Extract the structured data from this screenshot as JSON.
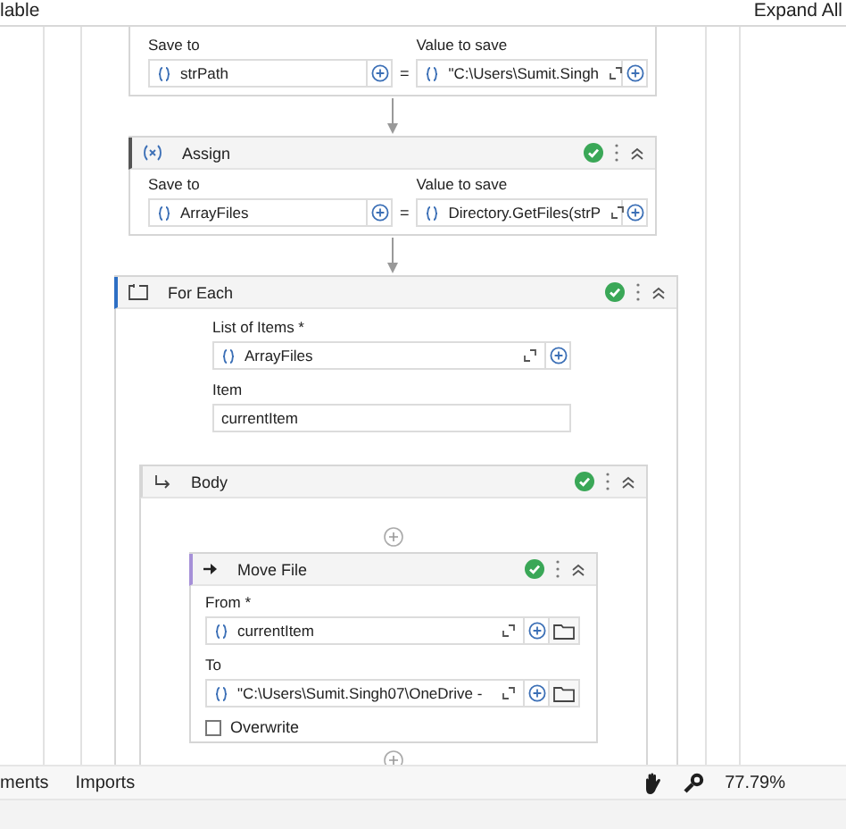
{
  "top_bar": {
    "left": "lable",
    "right": "Expand All"
  },
  "assign_partial": {
    "save_to_label": "Save to",
    "save_to": "strPath",
    "equals": "=",
    "value_label": "Value to save",
    "value": "\"C:\\Users\\Sumit.Singh"
  },
  "assign": {
    "title": "Assign",
    "save_to_label": "Save to",
    "save_to": "ArrayFiles",
    "equals": "=",
    "value_label": "Value to save",
    "value": "Directory.GetFiles(strP"
  },
  "for_each": {
    "title": "For Each",
    "list_label": "List of Items *",
    "list_value": "ArrayFiles",
    "item_label": "Item",
    "item_value": "currentItem",
    "body": {
      "title": "Body",
      "move_file": {
        "title": "Move File",
        "from_label": "From *",
        "from_value": "currentItem",
        "to_label": "To",
        "to_value": "\"C:\\Users\\Sumit.Singh07\\OneDrive -",
        "overwrite": {
          "label": "Overwrite",
          "checked": false
        }
      }
    }
  },
  "bottom_bar": {
    "tabs": [
      "ments",
      "Imports"
    ],
    "zoom": "77.79%"
  }
}
